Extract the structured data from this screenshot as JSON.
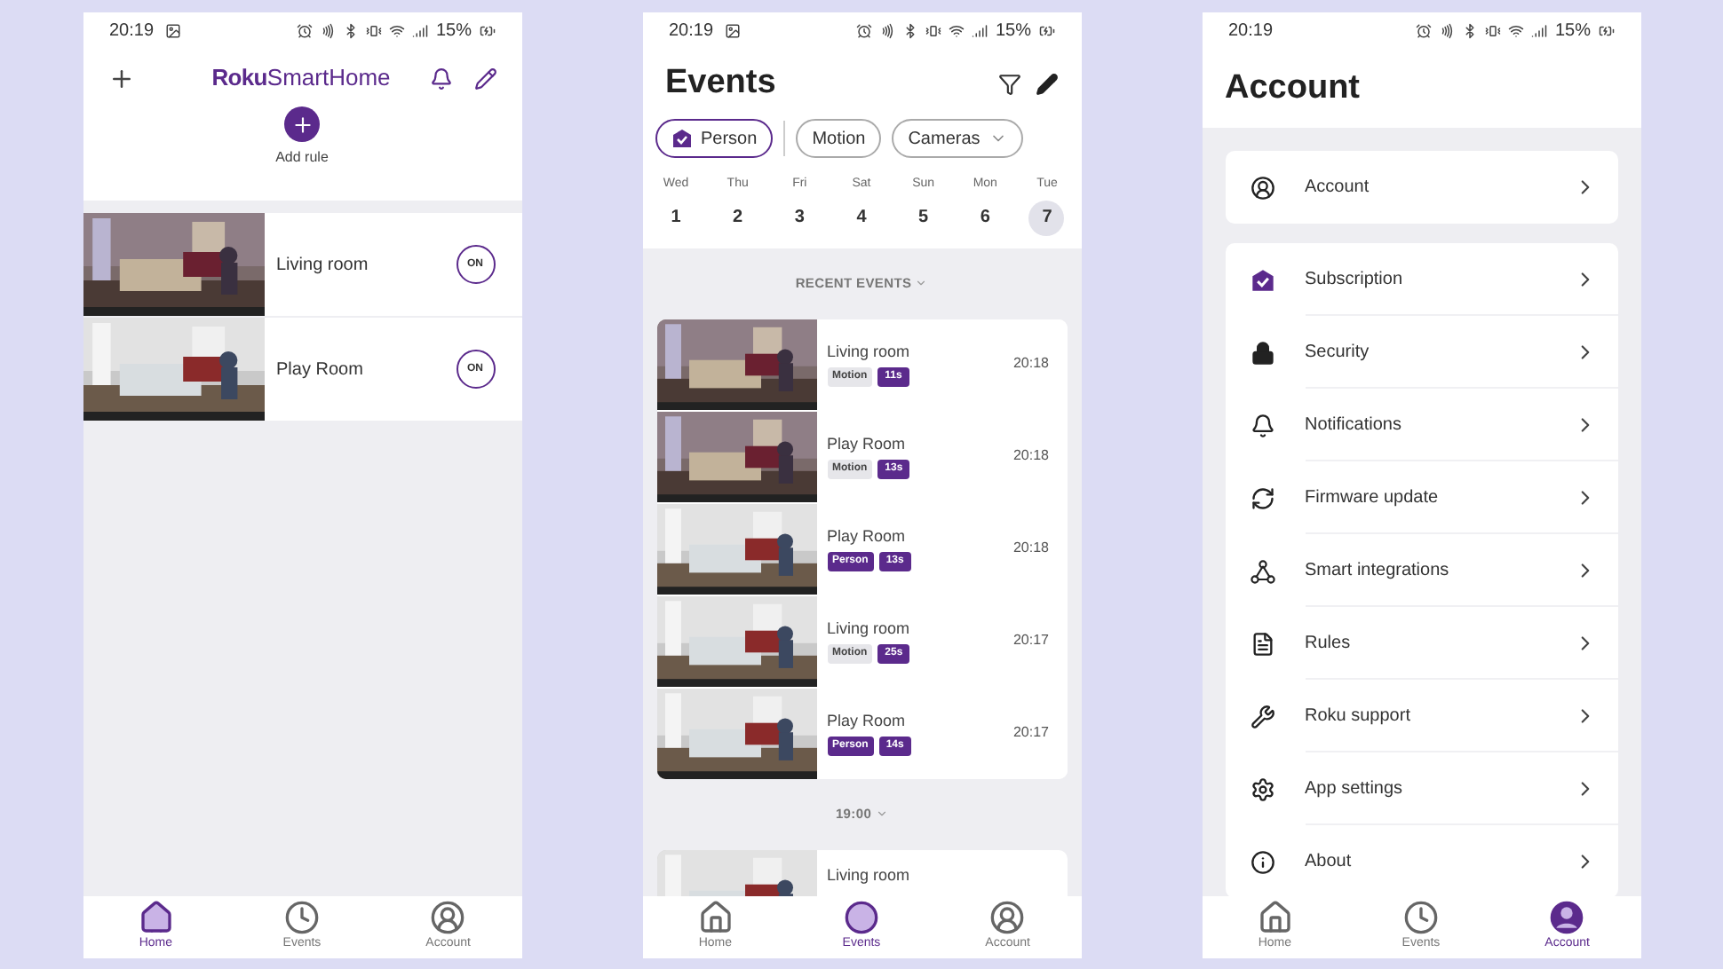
{
  "screens": [
    {
      "kind": "home",
      "status_bar": {
        "time": "20:19",
        "gallery_icon": true,
        "battery": "15%"
      },
      "header": {
        "logo_bold": "Roku",
        "logo_light": "SmartHome"
      },
      "add_rule": "Add rule",
      "cameras": [
        {
          "name": "Living room",
          "toggle": "ON"
        },
        {
          "name": "Play Room",
          "toggle": "ON"
        }
      ],
      "nav": [
        {
          "label": "Home",
          "kind": "home",
          "selected": true
        },
        {
          "label": "Events",
          "kind": "events",
          "selected": false
        },
        {
          "label": "Account",
          "kind": "account",
          "selected": false
        }
      ]
    },
    {
      "kind": "events",
      "status_bar": {
        "time": "20:19",
        "gallery_icon": true,
        "battery": "15%"
      },
      "title": "Events",
      "filters": [
        {
          "label": "Person",
          "kind": "person",
          "selected": true
        },
        {
          "label": "Motion",
          "kind": "chip",
          "selected": false
        },
        {
          "label": "Cameras",
          "kind": "dropdown",
          "selected": false
        }
      ],
      "days": [
        {
          "weekday": "Wed",
          "date": "1",
          "selected": false
        },
        {
          "weekday": "Thu",
          "date": "2",
          "selected": false
        },
        {
          "weekday": "Fri",
          "date": "3",
          "selected": false
        },
        {
          "weekday": "Sat",
          "date": "4",
          "selected": false
        },
        {
          "weekday": "Sun",
          "date": "5",
          "selected": false
        },
        {
          "weekday": "Mon",
          "date": "6",
          "selected": false
        },
        {
          "weekday": "Tue",
          "date": "7",
          "selected": true
        }
      ],
      "groups": [
        {
          "heading": "RECENT EVENTS",
          "events": [
            {
              "camera": "Living room",
              "tag": "Motion",
              "kind": "motion",
              "duration": "11s",
              "time": "20:18"
            },
            {
              "camera": "Play Room",
              "tag": "Motion",
              "kind": "motion",
              "duration": "13s",
              "time": "20:18"
            },
            {
              "camera": "Play Room",
              "tag": "Person",
              "kind": "person",
              "duration": "13s",
              "time": "20:18"
            },
            {
              "camera": "Living room",
              "tag": "Motion",
              "kind": "motion",
              "duration": "25s",
              "time": "20:17"
            },
            {
              "camera": "Play Room",
              "tag": "Person",
              "kind": "person",
              "duration": "14s",
              "time": "20:17"
            }
          ]
        },
        {
          "heading": "19:00",
          "events": [
            {
              "camera": "Living room"
            }
          ]
        }
      ],
      "nav": [
        {
          "label": "Home",
          "kind": "home",
          "selected": false
        },
        {
          "label": "Events",
          "kind": "events",
          "selected": true
        },
        {
          "label": "Account",
          "kind": "account",
          "selected": false
        }
      ]
    },
    {
      "kind": "account",
      "status_bar": {
        "time": "20:19",
        "gallery_icon": false,
        "battery": "15%"
      },
      "title": "Account",
      "groups": [
        [
          {
            "label": "Account",
            "kind": "profile"
          }
        ],
        [
          {
            "label": "Subscription",
            "kind": "subscription"
          },
          {
            "label": "Security",
            "kind": "security"
          },
          {
            "label": "Notifications",
            "kind": "notifications"
          },
          {
            "label": "Firmware update",
            "kind": "firmware"
          },
          {
            "label": "Smart integrations",
            "kind": "integrations"
          },
          {
            "label": "Rules",
            "kind": "rules"
          },
          {
            "label": "Roku support",
            "kind": "support"
          },
          {
            "label": "App settings",
            "kind": "settings"
          },
          {
            "label": "About",
            "kind": "about"
          }
        ]
      ],
      "nav": [
        {
          "label": "Home",
          "kind": "home",
          "selected": false
        },
        {
          "label": "Events",
          "kind": "events",
          "selected": false
        },
        {
          "label": "Account",
          "kind": "account",
          "selected": true
        }
      ]
    }
  ]
}
